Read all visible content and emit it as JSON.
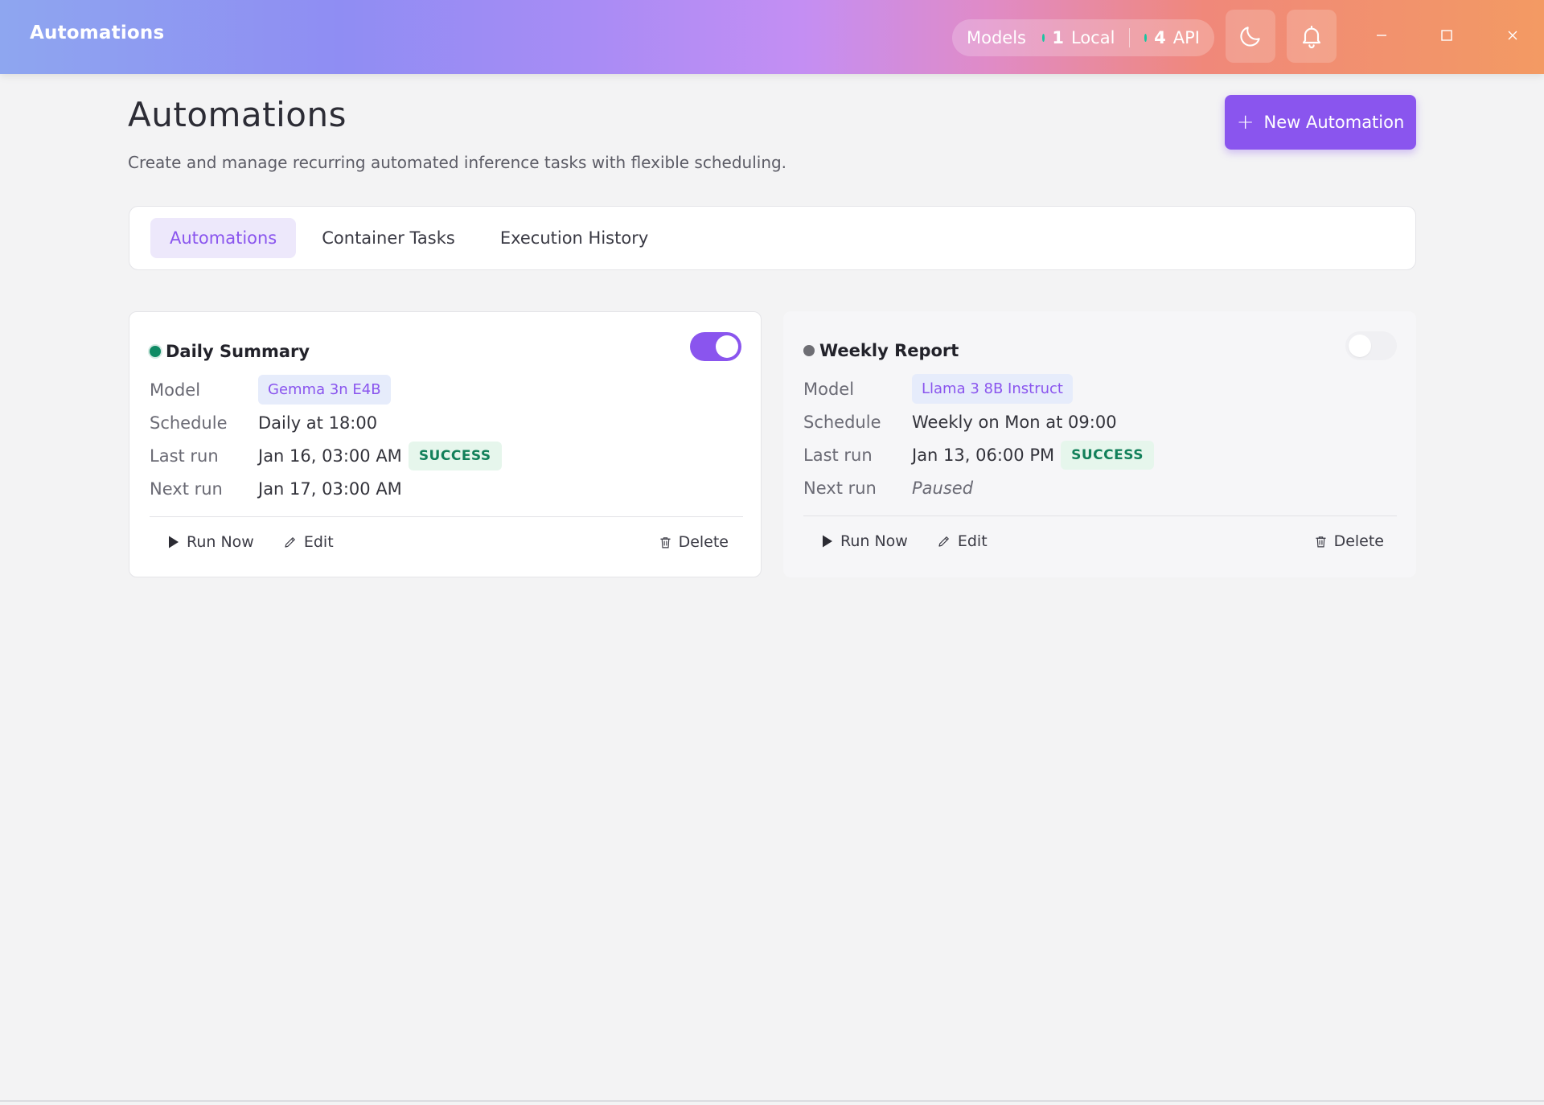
{
  "window": {
    "title": "Automations",
    "models": {
      "label": "Models",
      "local_count": "1",
      "local_label": "Local",
      "api_count": "4",
      "api_label": "API"
    }
  },
  "header": {
    "title": "Automations",
    "subtitle": "Create and manage recurring automated inference tasks with flexible scheduling.",
    "new_button": "New Automation"
  },
  "tabs": [
    {
      "label": "Automations",
      "active": true
    },
    {
      "label": "Container Tasks",
      "active": false
    },
    {
      "label": "Execution History",
      "active": false
    }
  ],
  "labels": {
    "model": "Model",
    "schedule": "Schedule",
    "last_run": "Last run",
    "next_run": "Next run"
  },
  "actions": {
    "run_now": "Run Now",
    "edit": "Edit",
    "delete": "Delete"
  },
  "automations": [
    {
      "name": "Daily Summary",
      "enabled": true,
      "model": "Gemma 3n E4B",
      "schedule": "Daily at 18:00",
      "last_run": "Jan 16, 03:00 AM",
      "last_status": "SUCCESS",
      "next_run": "Jan 17, 03:00 AM"
    },
    {
      "name": "Weekly Report",
      "enabled": false,
      "model": "Llama 3 8B Instruct",
      "schedule": "Weekly on Mon at 09:00",
      "last_run": "Jan 13, 06:00 PM",
      "last_status": "SUCCESS",
      "next_run": "Paused"
    }
  ],
  "colors": {
    "accent": "#8a55ee",
    "success": "#12805a",
    "active_dot": "#0f8a64",
    "paused_dot": "#6e6e74"
  }
}
